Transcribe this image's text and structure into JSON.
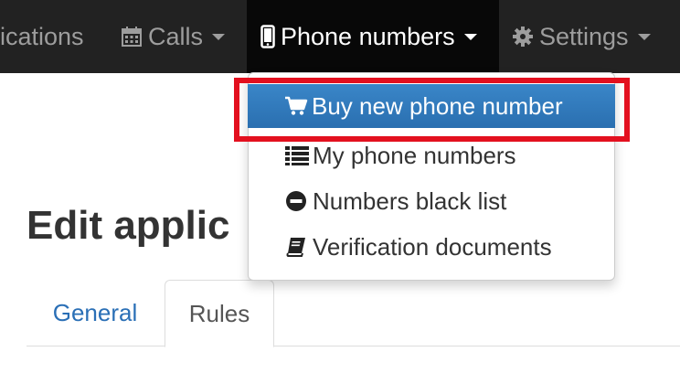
{
  "navbar": {
    "items": [
      {
        "label": "lications",
        "icon": "none"
      },
      {
        "label": "Calls",
        "icon": "calendar-icon"
      },
      {
        "label": "Phone numbers",
        "icon": "mobile-phone-icon",
        "active": true
      },
      {
        "label": "Settings",
        "icon": "gear-icon"
      }
    ]
  },
  "dropdown": {
    "items": [
      {
        "label": "Buy new phone number",
        "icon": "cart-icon",
        "selected": true
      },
      {
        "label": "My phone numbers",
        "icon": "list-icon"
      },
      {
        "label": "Numbers black list",
        "icon": "minus-circle-icon"
      },
      {
        "label": "Verification documents",
        "icon": "book-icon"
      }
    ]
  },
  "page": {
    "title": "Edit applic"
  },
  "tabs": [
    {
      "label": "General",
      "active": false
    },
    {
      "label": "Rules",
      "active": true
    }
  ],
  "colors": {
    "navbar_bg": "#222222",
    "active_nav_bg": "#080808",
    "selected_item_bg": "#337ab7",
    "highlight_border": "#e3101f",
    "link": "#2a6fb6"
  }
}
